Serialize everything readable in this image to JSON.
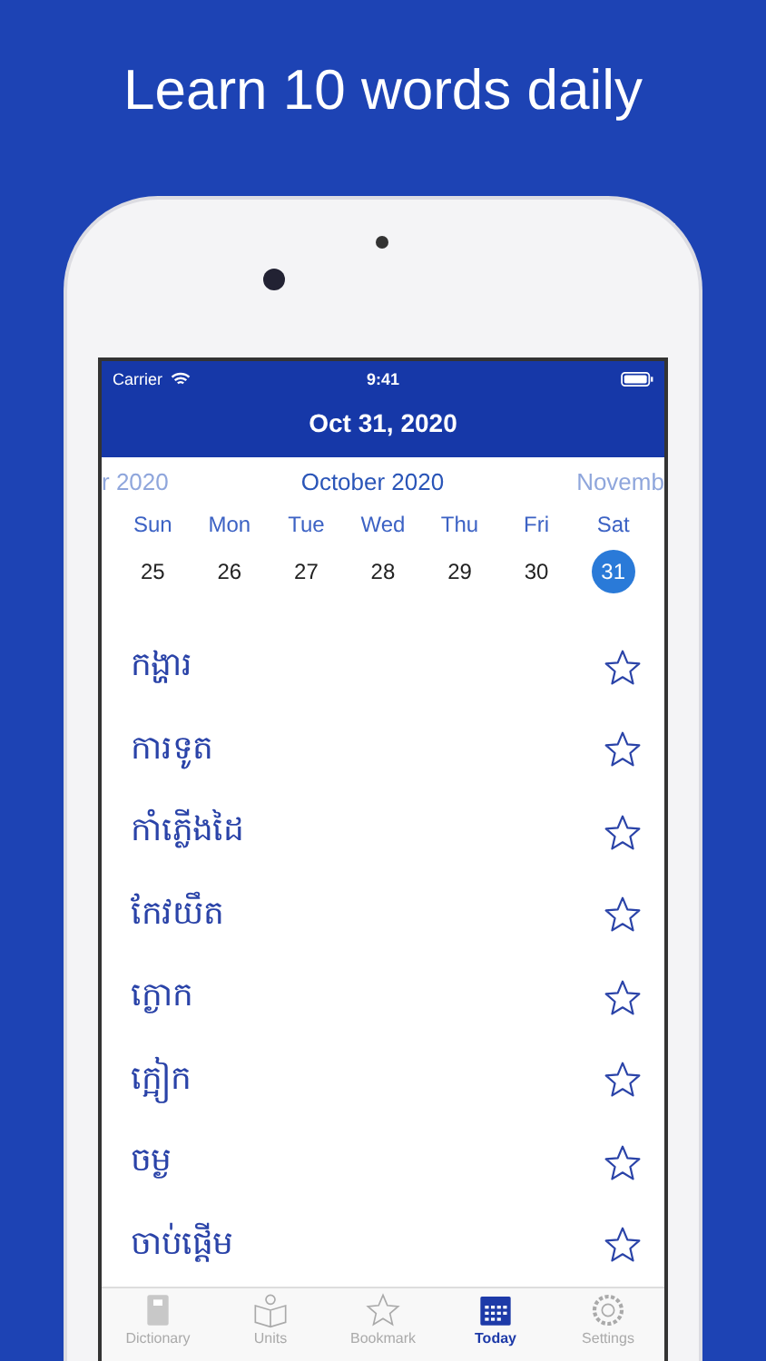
{
  "headline": "Learn 10 words daily",
  "status_bar": {
    "carrier": "Carrier",
    "time": "9:41"
  },
  "nav": {
    "title": "Oct 31, 2020"
  },
  "months": [
    {
      "label": "r 2020",
      "selected": false
    },
    {
      "label": "October 2020",
      "selected": true
    },
    {
      "label": "Novemb",
      "selected": false
    }
  ],
  "days": [
    {
      "weekday": "Sun",
      "date": "25",
      "selected": false
    },
    {
      "weekday": "Mon",
      "date": "26",
      "selected": false
    },
    {
      "weekday": "Tue",
      "date": "27",
      "selected": false
    },
    {
      "weekday": "Wed",
      "date": "28",
      "selected": false
    },
    {
      "weekday": "Thu",
      "date": "29",
      "selected": false
    },
    {
      "weekday": "Fri",
      "date": "30",
      "selected": false
    },
    {
      "weekday": "Sat",
      "date": "31",
      "selected": true
    }
  ],
  "words": [
    {
      "text": "កង្ហារ",
      "bookmarked": false
    },
    {
      "text": "ការទូត",
      "bookmarked": false
    },
    {
      "text": "កាំភ្លើងដៃ",
      "bookmarked": false
    },
    {
      "text": "កែវយឹត",
      "bookmarked": false
    },
    {
      "text": "ក្ងោក",
      "bookmarked": false
    },
    {
      "text": "ក្អៀក",
      "bookmarked": false
    },
    {
      "text": "ចម្ង",
      "bookmarked": false
    },
    {
      "text": "ចាប់ផ្តើម",
      "bookmarked": false
    }
  ],
  "tabs": [
    {
      "label": "Dictionary",
      "selected": false
    },
    {
      "label": "Units",
      "selected": false
    },
    {
      "label": "Bookmark",
      "selected": false
    },
    {
      "label": "Today",
      "selected": true
    },
    {
      "label": "Settings",
      "selected": false
    }
  ]
}
